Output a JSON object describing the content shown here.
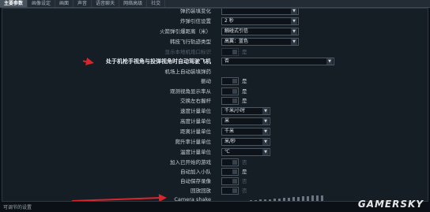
{
  "tabs": [
    "主要参数",
    "画像设定",
    "画面",
    "声音",
    "语音聊天",
    "网络高级",
    "社交"
  ],
  "rows": {
    "r0": {
      "label": "弹药装填变化"
    },
    "r1": {
      "label": "炸弹引信设置",
      "value": "2 秒"
    },
    "r2": {
      "label": "火箭弹引爆距离（米）",
      "value": "触碰式引信"
    },
    "r3": {
      "label": "韩技飞行轨迹类型",
      "value": "高翼：蓝色"
    },
    "r4": {
      "label": "显示本地机炮口标识",
      "yes": "是"
    },
    "r5": {
      "label": "处于机枪手视角与投弹视角时自动驾驶飞机",
      "value": "否"
    },
    "r6": {
      "label": "机场上自动装填弹药"
    },
    "r7": {
      "label": "振动",
      "yes": "是"
    },
    "r8": {
      "label": "观测视角显示率从",
      "yes": "是"
    },
    "r9": {
      "label": "交换左右握杆",
      "yes": "是"
    },
    "r10": {
      "label": "速度计量单位",
      "value": "千米/小时"
    },
    "r11": {
      "label": "高度计量单位",
      "value": "米"
    },
    "r12": {
      "label": "距离计量单位",
      "value": "千米"
    },
    "r13": {
      "label": "爬升率计量单位",
      "value": "米/秒"
    },
    "r14": {
      "label": "温度计量单位",
      "value": "℃"
    },
    "r15": {
      "label": "加入已开始的游戏",
      "yes": "否"
    },
    "r16": {
      "label": "自动加入小队",
      "yes": "是"
    },
    "r17": {
      "label": "自动保存录像",
      "yes": "否"
    },
    "r18": {
      "label": "回放回放",
      "yes": "否"
    },
    "r19": {
      "label": "Camera shake",
      "level": 1.0
    }
  },
  "status": "可调节的设置",
  "watermark": "GAMERSKY",
  "colors": {
    "accent_arrow": "#d9262d",
    "panel": "#151d25"
  }
}
